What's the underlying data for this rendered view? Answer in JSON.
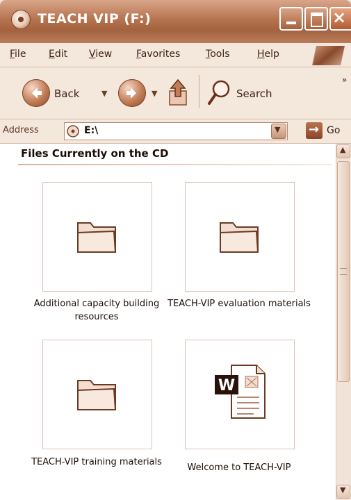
{
  "window": {
    "title": "TEACH VIP (F:)"
  },
  "menubar": {
    "items": [
      "File",
      "Edit",
      "View",
      "Favorites",
      "Tools",
      "Help"
    ]
  },
  "toolbar": {
    "back_label": "Back",
    "search_label": "Search",
    "overflow": "»"
  },
  "address": {
    "label": "Address",
    "value": "E:\\",
    "go_label": "Go"
  },
  "content": {
    "section_title": "Files Currently on the CD",
    "items": [
      {
        "label": "Additional capacity building resources",
        "type": "folder"
      },
      {
        "label": "TEACH-VIP evaluation materials",
        "type": "folder"
      },
      {
        "label": "TEACH-VIP training materials",
        "type": "folder"
      },
      {
        "label": "Welcome to TEACH-VIP",
        "type": "word-document"
      }
    ]
  },
  "colors": {
    "title_bar": "#b5744f",
    "window_bg": "#f4e7dc",
    "text": "#1c0e07"
  }
}
